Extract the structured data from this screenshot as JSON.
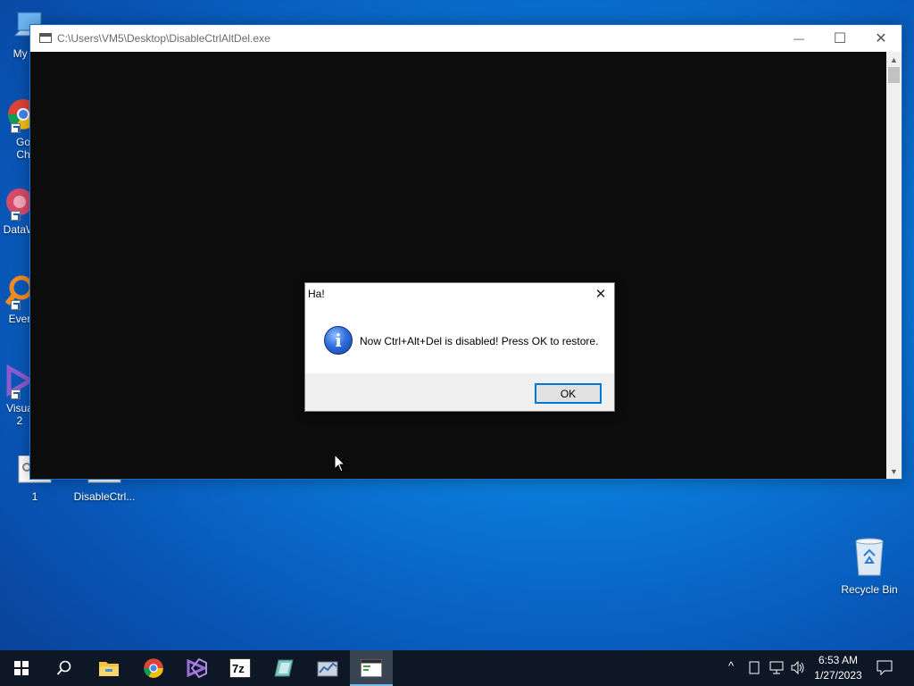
{
  "desktop": {
    "icons": [
      {
        "label": "My Co"
      },
      {
        "label_line1": "Go",
        "label_line2": "Ch"
      },
      {
        "label": "DataW"
      },
      {
        "label": "Ever"
      },
      {
        "label_line1": "Visua",
        "label_line2": "2"
      },
      {
        "label": "1"
      },
      {
        "label": "DisableCtrl..."
      },
      {
        "label": "Recycle Bin"
      }
    ]
  },
  "console_window": {
    "title": "C:\\Users\\VM5\\Desktop\\DisableCtrlAltDel.exe",
    "minimize_glyph": "—",
    "maximize_glyph": "☐",
    "close_glyph": "✕"
  },
  "message_box": {
    "title": "Ha!",
    "close_glyph": "✕",
    "icon_glyph": "i",
    "message": "Now Ctrl+Alt+Del is disabled! Press OK to restore.",
    "ok_label": "OK"
  },
  "taskbar": {
    "items": [
      "start-icon",
      "search-icon",
      "file-explorer-icon",
      "chrome-icon",
      "visual-studio-icon",
      "7zip-icon",
      "app-icon",
      "app-icon",
      "console-app-icon"
    ],
    "active_item": "console-app-icon",
    "tray_chevron": "^",
    "clock_time": "6:53 AM",
    "clock_date": "1/27/2023",
    "colors": {
      "taskbar_bg": "#0e1726",
      "accent": "#76b9ed"
    }
  }
}
